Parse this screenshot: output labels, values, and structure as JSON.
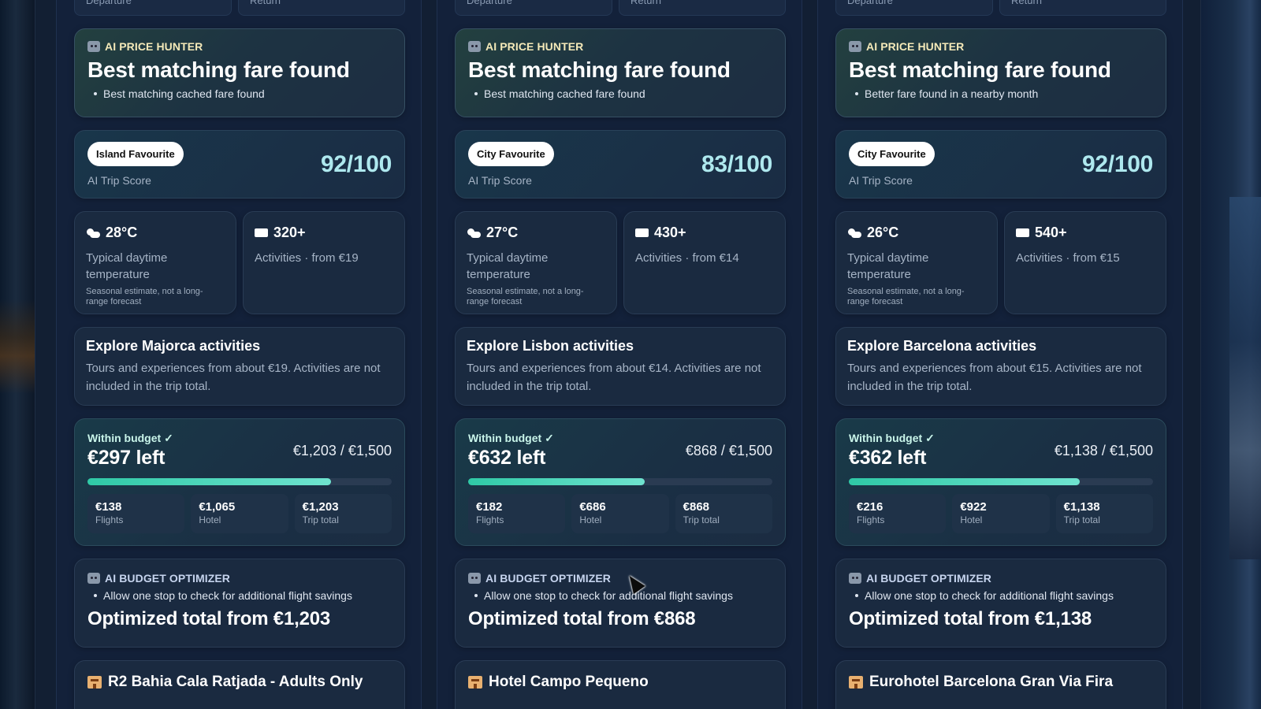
{
  "columns": [
    {
      "top_fields": [
        "Departure",
        "Return"
      ],
      "hunter": {
        "eyebrow": "AI PRICE HUNTER",
        "title": "Best matching fare found",
        "bullet": "Best matching cached fare found"
      },
      "score": {
        "badge": "Island Favourite",
        "label": "AI Trip Score",
        "value": "92/100"
      },
      "weather": {
        "value": "28°C",
        "text": "Typical daytime temperature",
        "note": "Seasonal estimate, not a long-range forecast"
      },
      "activities": {
        "value": "320+",
        "text": "Activities · from €19"
      },
      "explore": {
        "title": "Explore Majorca activities",
        "text": "Tours and experiences from about €19. Activities are not included in the trip total."
      },
      "budget": {
        "status": "Within budget ✓",
        "left": "€297 left",
        "ratio": "€1,203 / €1,500",
        "fill_fraction": 0.8,
        "items": [
          {
            "value": "€138",
            "label": "Flights"
          },
          {
            "value": "€1,065",
            "label": "Hotel"
          },
          {
            "value": "€1,203",
            "label": "Trip total"
          }
        ]
      },
      "optimizer": {
        "eyebrow": "AI BUDGET OPTIMIZER",
        "bullet": "Allow one stop to check for additional flight savings",
        "total": "Optimized total from €1,203"
      },
      "hotel": {
        "name": "R2 Bahia Cala Ratjada - Adults Only"
      }
    },
    {
      "top_fields": [
        "Departure",
        "Return"
      ],
      "hunter": {
        "eyebrow": "AI PRICE HUNTER",
        "title": "Best matching fare found",
        "bullet": "Best matching cached fare found"
      },
      "score": {
        "badge": "City Favourite",
        "label": "AI Trip Score",
        "value": "83/100"
      },
      "weather": {
        "value": "27°C",
        "text": "Typical daytime temperature",
        "note": "Seasonal estimate, not a long-range forecast"
      },
      "activities": {
        "value": "430+",
        "text": "Activities · from €14"
      },
      "explore": {
        "title": "Explore Lisbon activities",
        "text": "Tours and experiences from about €14. Activities are not included in the trip total."
      },
      "budget": {
        "status": "Within budget ✓",
        "left": "€632 left",
        "ratio": "€868 / €1,500",
        "fill_fraction": 0.58,
        "items": [
          {
            "value": "€182",
            "label": "Flights"
          },
          {
            "value": "€686",
            "label": "Hotel"
          },
          {
            "value": "€868",
            "label": "Trip total"
          }
        ]
      },
      "optimizer": {
        "eyebrow": "AI BUDGET OPTIMIZER",
        "bullet": "Allow one stop to check for additional flight savings",
        "total": "Optimized total from €868"
      },
      "hotel": {
        "name": "Hotel Campo Pequeno"
      }
    },
    {
      "top_fields": [
        "Departure",
        "Return"
      ],
      "hunter": {
        "eyebrow": "AI PRICE HUNTER",
        "title": "Best matching fare found",
        "bullet": "Better fare found in a nearby month"
      },
      "score": {
        "badge": "City Favourite",
        "label": "AI Trip Score",
        "value": "92/100"
      },
      "weather": {
        "value": "26°C",
        "text": "Typical daytime temperature",
        "note": "Seasonal estimate, not a long-range forecast"
      },
      "activities": {
        "value": "540+",
        "text": "Activities · from €15"
      },
      "explore": {
        "title": "Explore Barcelona activities",
        "text": "Tours and experiences from about €15. Activities are not included in the trip total."
      },
      "budget": {
        "status": "Within budget ✓",
        "left": "€362 left",
        "ratio": "€1,138 / €1,500",
        "fill_fraction": 0.76,
        "items": [
          {
            "value": "€216",
            "label": "Flights"
          },
          {
            "value": "€922",
            "label": "Hotel"
          },
          {
            "value": "€1,138",
            "label": "Trip total"
          }
        ]
      },
      "optimizer": {
        "eyebrow": "AI BUDGET OPTIMIZER",
        "bullet": "Allow one stop to check for additional flight savings",
        "total": "Optimized total from €1,138"
      },
      "hotel": {
        "name": "Eurohotel Barcelona Gran Via Fira"
      }
    }
  ],
  "colors": {
    "accent": "#aee8ee",
    "progress": "#3fd6b4",
    "eyebrow_gold": "#f4e9b8"
  },
  "icons": {
    "hunter": "robot-icon",
    "weather": "sun-cloud-icon",
    "activities": "ticket-icon",
    "optimizer": "robot-icon",
    "hotel": "hotel-icon"
  }
}
